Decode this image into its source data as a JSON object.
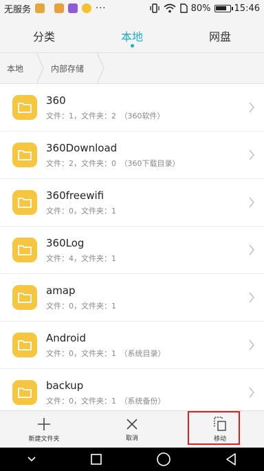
{
  "status_bar": {
    "carrier": "无服务",
    "battery_text": "80%",
    "battery_level": 0.8,
    "time": "15:46",
    "notification_dots": "···"
  },
  "tabs": [
    {
      "label": "分类",
      "active": false
    },
    {
      "label": "本地",
      "active": true
    },
    {
      "label": "网盘",
      "active": false
    }
  ],
  "breadcrumb": [
    "本地",
    "内部存储"
  ],
  "folders": [
    {
      "name": "360",
      "meta": "文件：1，文件夹：2　（360软件）"
    },
    {
      "name": "360Download",
      "meta": "文件：2，文件夹：0　（360下载目录）"
    },
    {
      "name": "360freewifi",
      "meta": "文件：0，文件夹：1"
    },
    {
      "name": "360Log",
      "meta": "文件：4，文件夹：1"
    },
    {
      "name": "amap",
      "meta": "文件：0，文件夹：1"
    },
    {
      "name": "Android",
      "meta": "文件：0，文件夹：1　（系统目录）"
    },
    {
      "name": "backup",
      "meta": "文件：0，文件夹：1　（系统备份）"
    }
  ],
  "actions": [
    {
      "label": "新建文件夹",
      "icon": "plus-icon"
    },
    {
      "label": "取消",
      "icon": "close-icon"
    },
    {
      "label": "移动",
      "icon": "move-icon"
    }
  ],
  "colors": {
    "accent": "#1ab0c4",
    "folder": "#f7c640",
    "highlight": "#e02020"
  }
}
